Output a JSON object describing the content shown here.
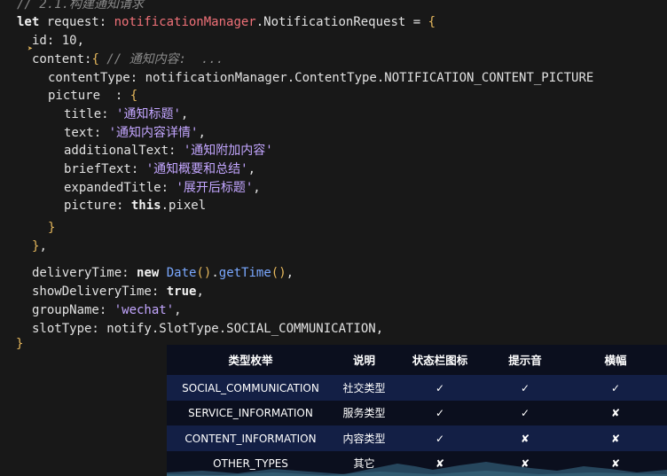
{
  "code": {
    "comment_top": "// 2.1.构建通知请求",
    "l1": {
      "kw": "let",
      "name": " request: ",
      "ns": "notificationManager",
      "rest": ".NotificationRequest = ",
      "brace": "{"
    },
    "l2": {
      "key": "id: ",
      "val": "10",
      "end": ","
    },
    "l3": {
      "key": "content:",
      "brace": "{",
      "comment": " // 通知内容:  ..."
    },
    "l4": {
      "text": "contentType: notificationManager.ContentType.NOTIFICATION_CONTENT_PICTURE"
    },
    "l5": {
      "key": "picture  : ",
      "brace": "{"
    },
    "l6": {
      "key": "title: ",
      "val": "'通知标题'",
      "end": ","
    },
    "l7": {
      "key": "text: ",
      "val": "'通知内容详情'",
      "end": ","
    },
    "l8": {
      "key": "additionalText: ",
      "val": "'通知附加内容'"
    },
    "l9": {
      "key": "briefText: ",
      "val": "'通知概要和总结'",
      "end": ","
    },
    "l10": {
      "key": "expandedTitle: ",
      "val": "'展开后标题'",
      "end": ","
    },
    "l11": {
      "key": "picture: ",
      "kw": "this",
      "rest": ".pixel"
    },
    "l12": {
      "brace": "}"
    },
    "l13": {
      "brace": "}",
      "end": ","
    },
    "l14": {
      "key": "deliveryTime: ",
      "kw": "new",
      "sp": " ",
      "cls": "Date",
      "p": "()",
      "dot": ".",
      "fn": "getTime",
      "p2": "()",
      "end": ","
    },
    "l15": {
      "key": "showDeliveryTime: ",
      "kw": "true",
      "end": ","
    },
    "l16": {
      "key": "groupName: ",
      "val": "'wechat'",
      "end": ","
    },
    "l17": {
      "text": "slotType: notify.SlotType.SOCIAL_COMMUNICATION,"
    },
    "l18": {
      "brace": "}"
    }
  },
  "table": {
    "headers": [
      "类型枚举",
      "说明",
      "状态栏图标",
      "提示音",
      "横幅"
    ],
    "rows": [
      [
        "SOCIAL_COMMUNICATION",
        "社交类型",
        "✓",
        "✓",
        "✓"
      ],
      [
        "SERVICE_INFORMATION",
        "服务类型",
        "✓",
        "✓",
        "✘"
      ],
      [
        "CONTENT_INFORMATION",
        "内容类型",
        "✓",
        "✘",
        "✘"
      ],
      [
        "OTHER_TYPES",
        "其它",
        "✘",
        "✘",
        "✘"
      ]
    ]
  }
}
